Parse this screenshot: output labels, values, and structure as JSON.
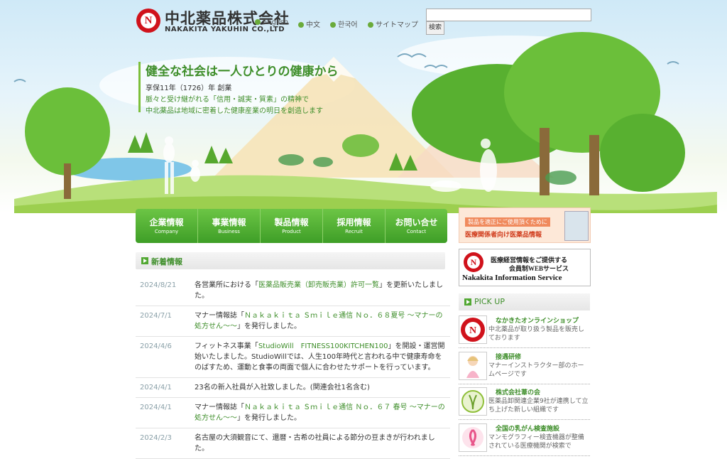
{
  "header": {
    "company_name": "中北薬品株式会社",
    "company_name_en": "NAKAKITA YAKUHIN CO.,LTD",
    "logo_letter": "N",
    "languages": [
      "English",
      "中文",
      "한국어",
      "サイトマップ"
    ],
    "search_placeholder": "",
    "search_button": "検索"
  },
  "hero": {
    "tagline": "健全な社会は一人ひとりの健康から",
    "lines": [
      "享保11年（1726）年 創業",
      "脈々と受け継がれる「信用・誠実・質素」の精神で",
      "中北薬品は地域に密着した健康産業の明日を創造します"
    ]
  },
  "nav": [
    {
      "jp": "企業情報",
      "en": "Company"
    },
    {
      "jp": "事業情報",
      "en": "Business"
    },
    {
      "jp": "製品情報",
      "en": "Product"
    },
    {
      "jp": "採用情報",
      "en": "Recruit"
    },
    {
      "jp": "お問い合せ",
      "en": "Contact"
    }
  ],
  "news": {
    "title": "新着情報",
    "items": [
      {
        "date": "2024/8/21",
        "pre": "各営業所における「",
        "link": "医薬品販売業（卸売販売業）許可一覧",
        "post": "」を更新いたしました。"
      },
      {
        "date": "2024/7/1",
        "pre": "マナー情報誌「",
        "link": "Ｎａｋａｋｉｔａ Ｓｍｉｌｅ通信 Ｎｏ．６８夏号 ～マナーの処方せん～～",
        "post": "」を発行しました。"
      },
      {
        "date": "2024/4/6",
        "pre": "フィットネス事業「",
        "link": "StudioWill　FITNESS100KITCHEN100",
        "post": "」を開設・運営開始いたしました。StudioWillでは、人生100年時代と言われる中で健康寿命をのばすため、運動と食事の両面で個人に合わせたサポートを行っています。"
      },
      {
        "date": "2024/4/1",
        "pre": "23名の新入社員が入社致しました。(関連会社1名含む)",
        "link": "",
        "post": ""
      },
      {
        "date": "2024/4/1",
        "pre": "マナー情報誌「",
        "link": "Ｎａｋａｋｉｔａ Ｓｍｉｌｅ通信 Ｎｏ．６７ 春号 ～マナーの処方せん～～",
        "post": "」を発行しました。"
      },
      {
        "date": "2024/2/3",
        "pre": "名古屋の大須観音にて、還暦・古希の社員による節分の豆まきが行われました。",
        "link": "",
        "post": ""
      }
    ]
  },
  "sidebar": {
    "medical_banner": {
      "line1": "製品を適正にご使用頂くために",
      "line2": "医療関係者向け医薬品情報"
    },
    "info_banner": {
      "line1": "医療経営情報をご提供する",
      "line2": "会員制WEBサービス",
      "line3": "Nakakita Information Service"
    },
    "pickup_title": "PICK UP",
    "pickups": [
      {
        "title": "なかきたオンラインショップ",
        "desc": "中北薬品が取り扱う製品を販売しております"
      },
      {
        "title": "接遇研修",
        "desc": "マナーインストラクター部のホームページです"
      },
      {
        "title": "株式会社葦の会",
        "desc": "医薬品卸関連企業9社が連携して立ち上げた新しい組織です"
      },
      {
        "title": "全国の乳がん検査施設",
        "desc": "マンモグラフィー検査機器が整備されている医療機関が検索で"
      }
    ]
  },
  "colors": {
    "brand_red": "#d0121b",
    "accent_green": "#3e8e2a",
    "nav_green": "#52a832"
  }
}
